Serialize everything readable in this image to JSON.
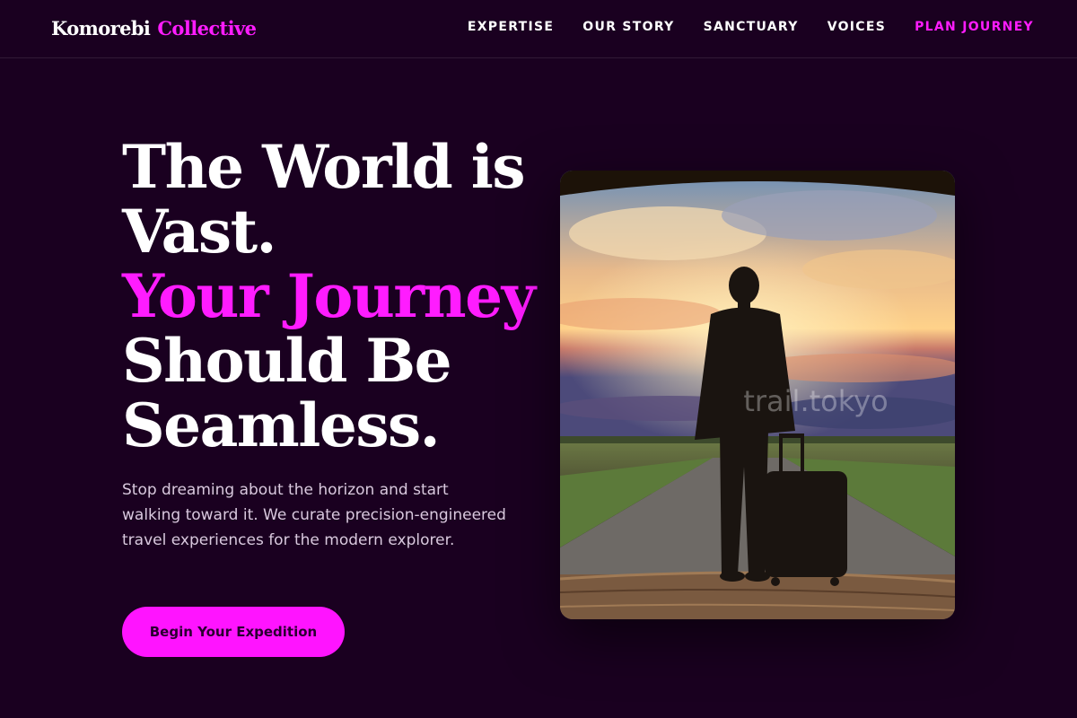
{
  "header": {
    "brand_primary": "Komorebi",
    "brand_secondary": "Collective",
    "nav": [
      {
        "label": "EXPERTISE"
      },
      {
        "label": "OUR STORY"
      },
      {
        "label": "SANCTUARY"
      },
      {
        "label": "VOICES"
      },
      {
        "label": "PLAN JOURNEY"
      }
    ]
  },
  "hero": {
    "title_lines": [
      "The World is",
      "Vast.",
      "Your Journey",
      "Should Be",
      "Seamless."
    ],
    "description": "Stop dreaming about the horizon and start walking toward it. We curate precision-engineered travel experiences for the modern explorer.",
    "cta_label": "Begin Your Expedition",
    "image_watermark": "trail.tokyo"
  },
  "colors": {
    "background": "#1a0020",
    "accent": "#ff1cff",
    "text": "#ffffff",
    "muted_text": "#d9c9de"
  }
}
